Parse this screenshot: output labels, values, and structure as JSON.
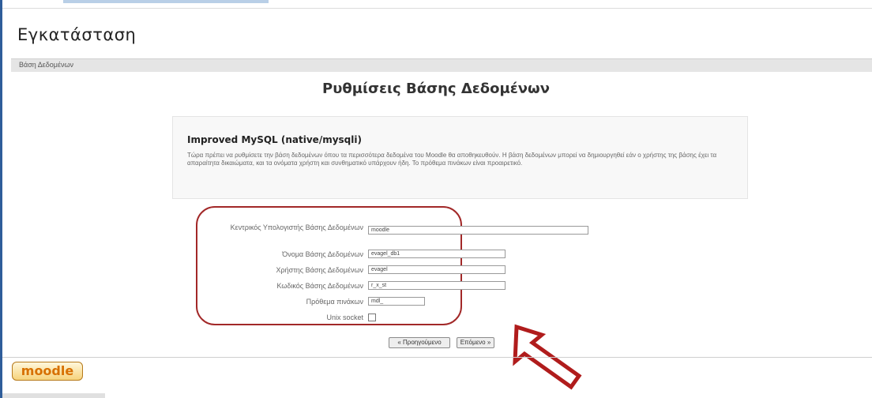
{
  "page": {
    "heading": "Εγκατάσταση",
    "breadcrumb": "Βάση Δεδομένων",
    "section_title": "Ρυθμίσεις Βάσης Δεδομένων"
  },
  "driver": {
    "title": "Improved MySQL (native/mysqli)",
    "description": "Τώρα πρέπει να ρυθμίσετε την βάση δεδομένων όπου τα περισσότερα δεδομένα του Moodle θα αποθηκευθούν. Η βάση δεδομένων μπορεί να δημιουργηθεί εάν ο χρήστης της βάσης έχει τα απαραίτητα δικαιώματα, και τα ονόματα χρήστη και συνθηματικό υπάρχουν ήδη. Το πρόθεμα πινάκων είναι προαιρετικό."
  },
  "form": {
    "host_label": "Κεντρικός Υπολογιστής Βάσης Δεδομένων",
    "host_value": "moodle",
    "dbname_label": "Όνομα Βάσης Δεδομένων",
    "dbname_value": "evagel_db1",
    "user_label": "Χρήστης Βάσης Δεδομένων",
    "user_value": "evagel",
    "password_label": "Κωδικός Βάσης Δεδομένων",
    "password_value": "r_x_st",
    "prefix_label": "Πρόθεμα πινάκων",
    "prefix_value": "mdl_",
    "socket_label": "Unix socket",
    "socket_checked": false
  },
  "buttons": {
    "previous": "« Προηγούμενο",
    "next": "Επόμενο »"
  },
  "footer": {
    "logo_text": "moodle"
  },
  "colors": {
    "highlight": "#a22828",
    "arrow": "#b01c1c"
  }
}
